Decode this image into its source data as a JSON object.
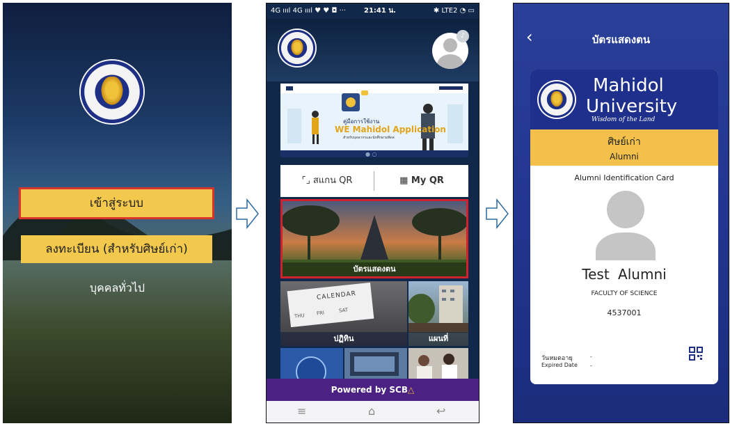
{
  "panel1": {
    "login_label": "เข้าสู่ระบบ",
    "register_label": "ลงทะเบียน (สำหรับศิษย์เก่า)",
    "guest_label": "บุคคลทั่วไป"
  },
  "panel2": {
    "status": {
      "signals": "4G ıııl 4G ıııl ♥ ♥ ◘  ···",
      "time": "21:41 น.",
      "right": "✱ LTE2 ◔ ▭"
    },
    "banner": {
      "title_th": "คู่มือการใช้งาน",
      "title_en": "WE Mahidol Application",
      "subtitle": "สำหรับบุคลากรและนักศึกษามหิดล",
      "dots": "● ○"
    },
    "scan_qr_label": "⌜⌟ สแกน QR",
    "my_qr_label": "▦ My QR",
    "id_card_label": "บัตรแสดงตน",
    "calendar": {
      "word": "CALENDAR",
      "days": [
        "THU",
        "FRI",
        "SAT"
      ],
      "label": "ปฏิทิน"
    },
    "map_label": "แผนที่",
    "powered_by": "Powered by SCB",
    "powered_icon": "△",
    "nav": {
      "menu": "≡",
      "home": "⌂",
      "back": "↩"
    }
  },
  "panel3": {
    "back_icon": "‹",
    "title": "บัตรแสดงตน",
    "card": {
      "university_line1": "Mahidol",
      "university_line2": "University",
      "motto": "Wisdom of the Land",
      "band_th": "ศิษย์เก่า",
      "band_en": "Alumni",
      "card_type": "Alumni Identification Card",
      "name": "Test Alumni",
      "faculty": "FACULTY OF SCIENCE",
      "id_number": "4537001",
      "expiry_label_th": "วันหมดอายุ",
      "expiry_label_en": "Expired Date",
      "expiry_value": "-"
    }
  },
  "colors": {
    "gold": "#f2c94c",
    "highlight_red": "#d4202a",
    "navy": "#1f2f8c",
    "scb_purple": "#4b2283"
  }
}
